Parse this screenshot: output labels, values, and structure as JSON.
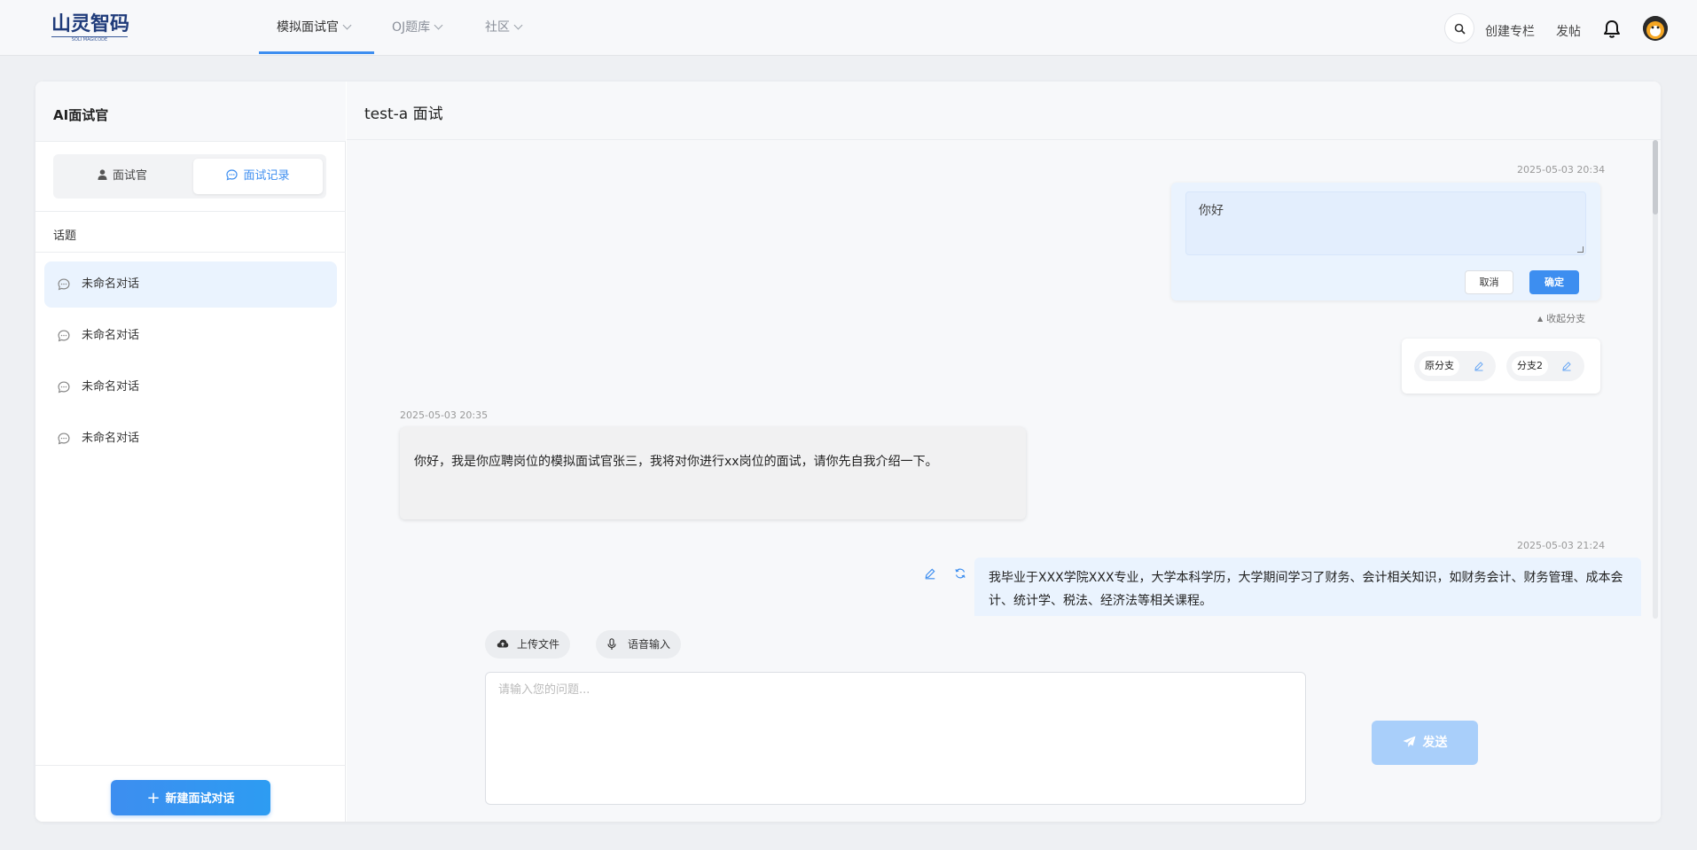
{
  "brand": {
    "name": "山灵智码",
    "subtitle": "SOLI MAGICODE"
  },
  "nav": {
    "items": [
      {
        "label": "模拟面试官",
        "active": true
      },
      {
        "label": "OJ题库",
        "active": false
      },
      {
        "label": "社区",
        "active": false
      }
    ],
    "create_column": "创建专栏",
    "post": "发帖"
  },
  "sidebar": {
    "title": "AI面试官",
    "tabs": [
      {
        "label": "面试官",
        "active": false,
        "icon": "user-icon"
      },
      {
        "label": "面试记录",
        "active": true,
        "icon": "chat-icon"
      }
    ],
    "topics_label": "话题",
    "conversations": [
      {
        "label": "未命名对话",
        "active": true
      },
      {
        "label": "未命名对话",
        "active": false
      },
      {
        "label": "未命名对话",
        "active": false
      },
      {
        "label": "未命名对话",
        "active": false
      }
    ],
    "new_button": "新建面试对话"
  },
  "chat": {
    "title": "test-a 面试",
    "edit": {
      "timestamp": "2025-05-03 20:34",
      "value": "你好",
      "cancel": "取消",
      "confirm": "确定"
    },
    "collapse_branches": "收起分支",
    "branches": [
      {
        "label": "原分支"
      },
      {
        "label": "分支2"
      }
    ],
    "ai_message": {
      "timestamp": "2025-05-03 20:35",
      "text": "你好，我是你应聘岗位的模拟面试官张三，我将对你进行xx岗位的面试，请你先自我介绍一下。"
    },
    "user_message": {
      "timestamp": "2025-05-03 21:24",
      "text": "我毕业于XXX学院XXX专业，大学本科学历，大学期间学习了财务、会计相关知识，如财务会计、财务管理、成本会计、统计学、税法、经济法等相关课程。"
    },
    "upload_file": "上传文件",
    "voice_input": "语音输入",
    "input_placeholder": "请输入您的问题...",
    "send": "发送"
  },
  "colors": {
    "accent": "#3d8ef0",
    "send_disabled": "#a9cffa"
  }
}
